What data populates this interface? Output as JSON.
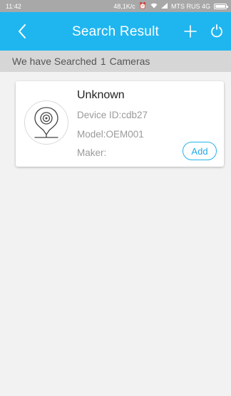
{
  "status_bar": {
    "time": "11:42",
    "speed": "48,1K/c",
    "carrier": "MTS RUS 4G"
  },
  "header": {
    "title": "Search Result",
    "back_icon": "chevron-left-icon",
    "add_icon": "plus-icon",
    "refresh_icon": "refresh-icon"
  },
  "result": {
    "prefix": "We have Searched",
    "count": "1",
    "suffix": "Cameras"
  },
  "devices": [
    {
      "name": "Unknown",
      "device_id": "Device ID:cdb27",
      "model": "Model:OEM001",
      "maker": "Maker:",
      "add_label": "Add",
      "icon": "ip-camera-icon"
    }
  ],
  "colors": {
    "accent": "#1fb6f0",
    "status_bar": "#a8a8a8",
    "result_bar": "#d6d6d6",
    "background": "#f2f2f2"
  }
}
